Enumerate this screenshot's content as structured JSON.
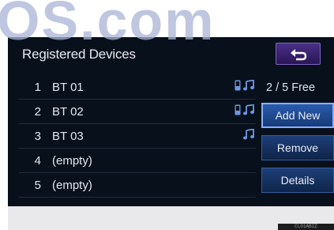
{
  "watermark": {
    "text": "OS.com"
  },
  "screen": {
    "title": "Registered Devices",
    "back_icon": "return-arrow-icon",
    "free_status": "2 / 5 Free",
    "devices": [
      {
        "number": "1",
        "name": "BT 01",
        "icons": [
          "phone-icon",
          "music-note-icon"
        ]
      },
      {
        "number": "2",
        "name": "BT 02",
        "icons": [
          "phone-icon",
          "music-note-icon"
        ]
      },
      {
        "number": "3",
        "name": "BT 03",
        "icons": [
          "music-note-icon"
        ]
      },
      {
        "number": "4",
        "name": "(empty)",
        "icons": []
      },
      {
        "number": "5",
        "name": "(empty)",
        "icons": []
      }
    ],
    "buttons": {
      "add_new": "Add New",
      "remove": "Remove",
      "details": "Details"
    }
  },
  "footer": {
    "code": "CL01ABIZ"
  },
  "colors": {
    "screen_background": "#08101c",
    "button_blue": "#1d3f78",
    "active_border": "#8ab0ff",
    "back_button_purple": "#4a2f86",
    "icon_blue": "#6f97e0"
  }
}
